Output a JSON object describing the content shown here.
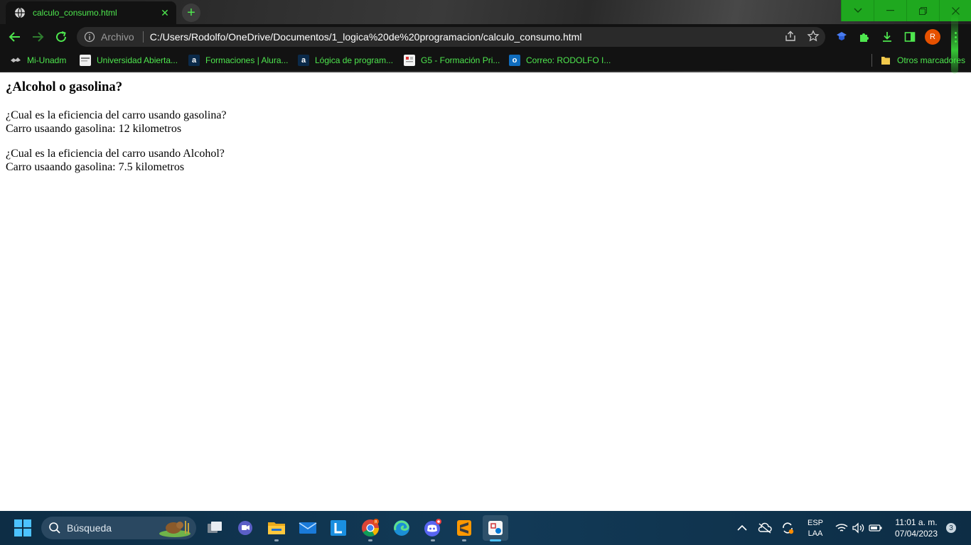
{
  "browser": {
    "tab": {
      "title": "calculo_consumo.html"
    },
    "window_controls": [
      "dropdown",
      "minimize",
      "restore",
      "close"
    ],
    "address_bar": {
      "scheme_label": "Archivo",
      "url": "C:/Users/Rodolfo/OneDrive/Documentos/1_logica%20de%20programacion/calculo_consumo.html"
    },
    "profile_initial": "R",
    "accent_color": "#4ee64e",
    "bookmarks": [
      {
        "label": "Mi-Unadm",
        "icon": "unadm-icon"
      },
      {
        "label": "Universidad Abierta...",
        "icon": "unadm-page-icon"
      },
      {
        "label": "Formaciones | Alura...",
        "icon": "alura-icon"
      },
      {
        "label": "Lógica de program...",
        "icon": "alura-icon"
      },
      {
        "label": "G5 - Formación Pri...",
        "icon": "document-icon"
      },
      {
        "label": "Correo: RODOLFO I...",
        "icon": "outlook-icon"
      }
    ],
    "other_bookmarks": "Otros marcadores"
  },
  "page": {
    "heading": "¿Alcohol o gasolina?",
    "blocks": [
      {
        "question": "¿Cual es la eficiencia del carro usando gasolina?",
        "result": "Carro usaando gasolina: 12 kilometros"
      },
      {
        "question": "¿Cual es la eficiencia del carro usando Alcohol?",
        "result": "Carro usaando gasolina: 7.5 kilometros"
      }
    ]
  },
  "taskbar": {
    "search_placeholder": "Búsqueda",
    "apps": [
      "task-view",
      "teams-chat",
      "file-explorer",
      "mail",
      "l-app",
      "chrome",
      "edge",
      "discord",
      "sublime-text",
      "snipping-tool"
    ],
    "language": {
      "line1": "ESP",
      "line2": "LAA"
    },
    "clock": {
      "time": "11:01 a. m.",
      "date": "07/04/2023"
    },
    "notification_count": "3"
  }
}
